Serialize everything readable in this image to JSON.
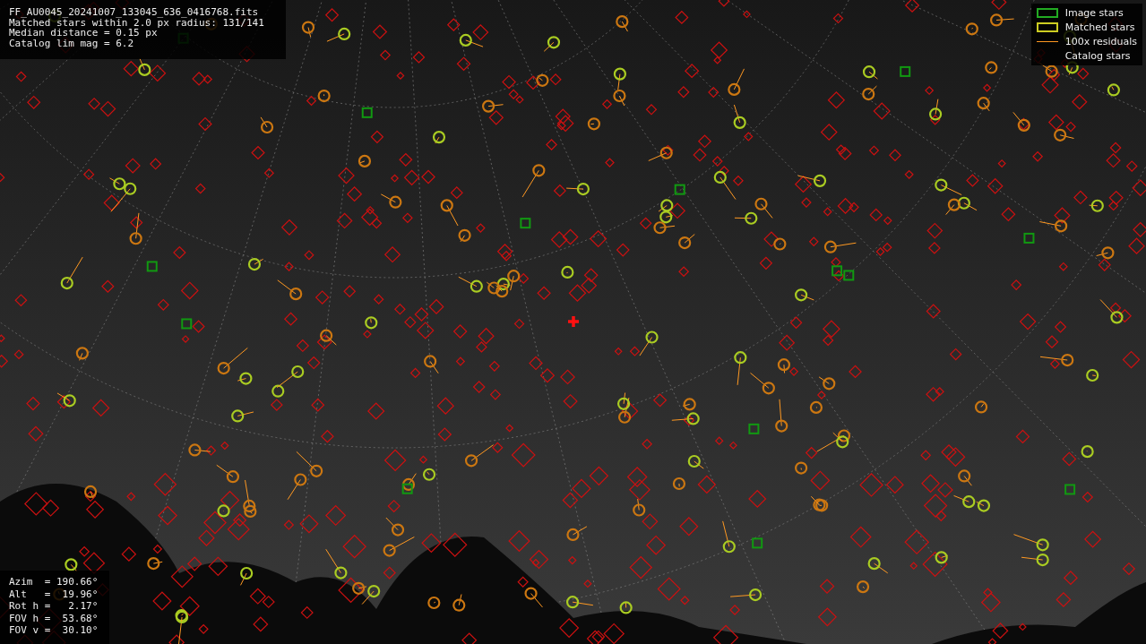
{
  "header": {
    "lines": [
      "FF_AU0045_20241007_133045_636_0416768.fits",
      "Matched stars within 2.0 px radius: 131/141",
      "Median distance = 0.15 px",
      "Catalog lim mag = 6.2"
    ]
  },
  "legend": {
    "items": [
      {
        "kind": "box",
        "color": "#22aa22",
        "label": "Image stars"
      },
      {
        "kind": "box",
        "color": "#cccc22",
        "label": "Matched stars"
      },
      {
        "kind": "line",
        "color": "#ff9922",
        "label": "100x residuals"
      },
      {
        "kind": "none",
        "label": "Catalog stars"
      }
    ]
  },
  "pointing": {
    "lines": [
      "Azim  = 190.66°",
      "Alt   =  19.96°",
      "Rot h =   2.17°",
      "FOV h =  53.68°",
      "FOV v =  30.10°"
    ]
  }
}
